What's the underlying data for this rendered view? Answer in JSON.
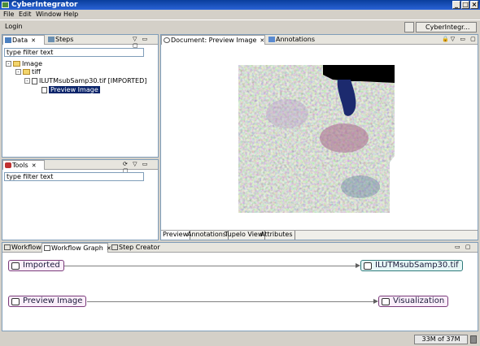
{
  "window": {
    "title": "CyberIntegrator"
  },
  "menu": [
    "File",
    "Edit",
    "Window",
    "Help"
  ],
  "toolbar": {
    "login": "Login",
    "perspective": "CyberIntegr..."
  },
  "data_view": {
    "tabs": [
      {
        "label": "Data"
      },
      {
        "label": "Steps"
      }
    ],
    "filter_placeholder": "type filter text",
    "tree": [
      {
        "label": "Image",
        "level": 0
      },
      {
        "label": "tiff",
        "level": 1
      },
      {
        "label": "ILUTMsubSamp30.tif [IMPORTED]",
        "level": 2
      },
      {
        "label": "Preview Image",
        "level": 3,
        "selected": true
      }
    ]
  },
  "tools_view": {
    "tabs": [
      {
        "label": "Tools"
      }
    ],
    "filter_placeholder": "type filter text"
  },
  "document": {
    "tabs": [
      {
        "label": "Document: Preview Image"
      },
      {
        "label": "Annotations"
      }
    ],
    "bottom_tabs": [
      "Preview",
      "Annotations",
      "Tupelo View",
      "Attributes"
    ]
  },
  "workflow": {
    "tabs": [
      {
        "label": "Workflow"
      },
      {
        "label": "Workflow Graph"
      },
      {
        "label": "Step Creator"
      }
    ],
    "nodes": {
      "imported": "Imported",
      "file": "ILUTMsubSamp30.tif",
      "preview": "Preview Image",
      "visualization": "Visualization"
    }
  },
  "status": {
    "memory": "33M of 37M"
  }
}
